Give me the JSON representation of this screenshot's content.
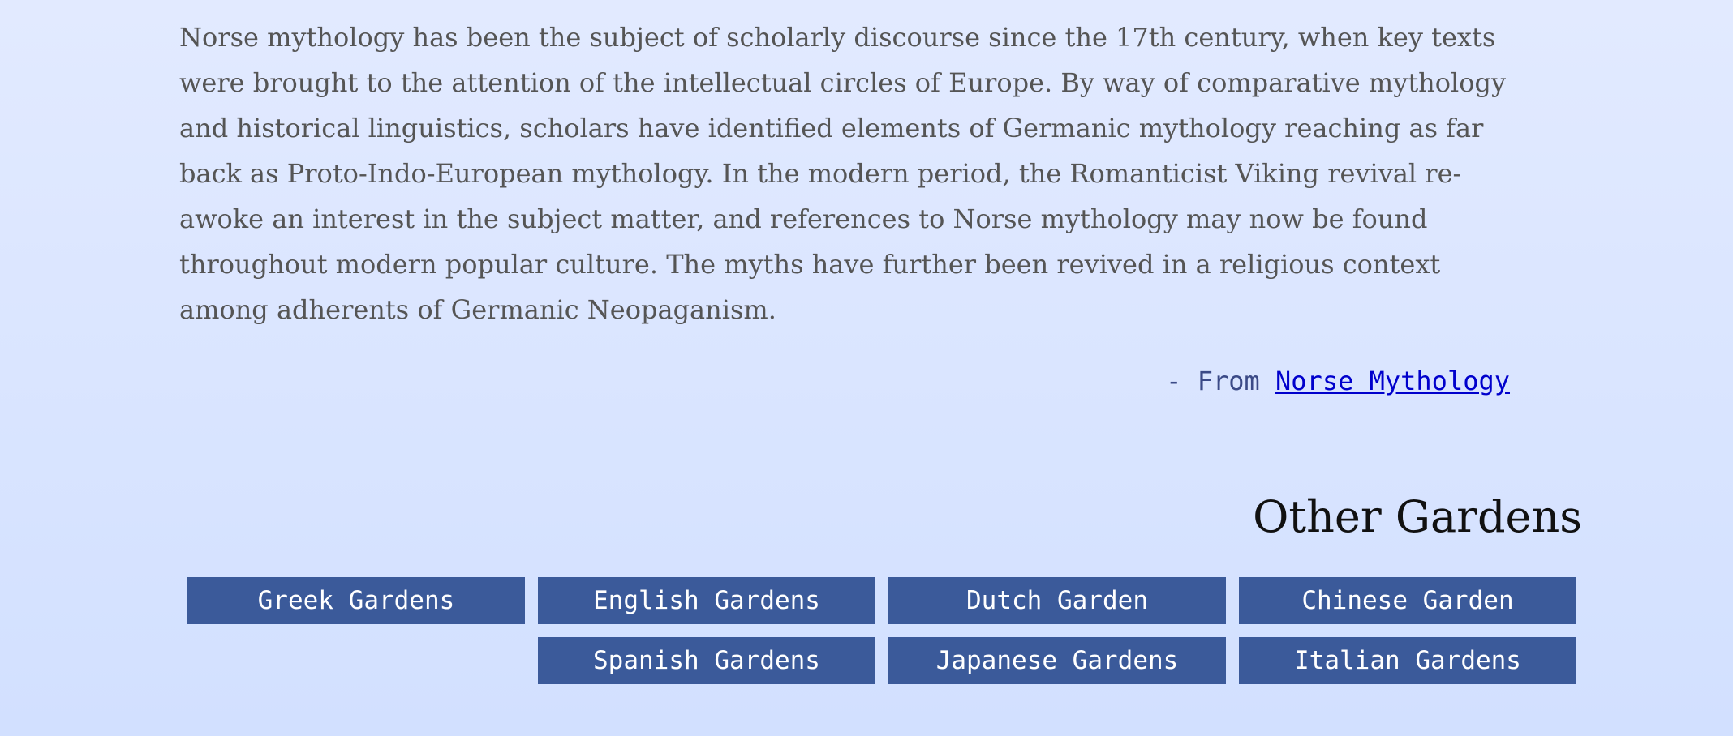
{
  "quote": {
    "text": "Norse mythology has been the subject of scholarly discourse since the 17th century, when key texts were brought to the attention of the intellectual circles of Europe. By way of comparative mythology and historical linguistics, scholars have identified elements of Germanic mythology reaching as far back as Proto-Indo-European mythology. In the modern period, the Romanticist Viking revival re-awoke an interest in the subject matter, and references to Norse mythology may now be found throughout modern popular culture. The myths have further been revived in a religious context among adherents of Germanic Neopaganism.",
    "attribution_prefix": "- From ",
    "attribution_link": "Norse Mythology"
  },
  "other_gardens": {
    "title": "Other Gardens",
    "buttons": [
      "Greek Gardens",
      "English Gardens",
      "Dutch Garden",
      "Chinese Garden",
      "Spanish Gardens",
      "Japanese Gardens",
      "Italian Gardens"
    ]
  },
  "colors": {
    "background_top": "#e2eaff",
    "background_bottom": "#d2e0ff",
    "button": "#3b5a9a",
    "link": "#0000cc"
  }
}
